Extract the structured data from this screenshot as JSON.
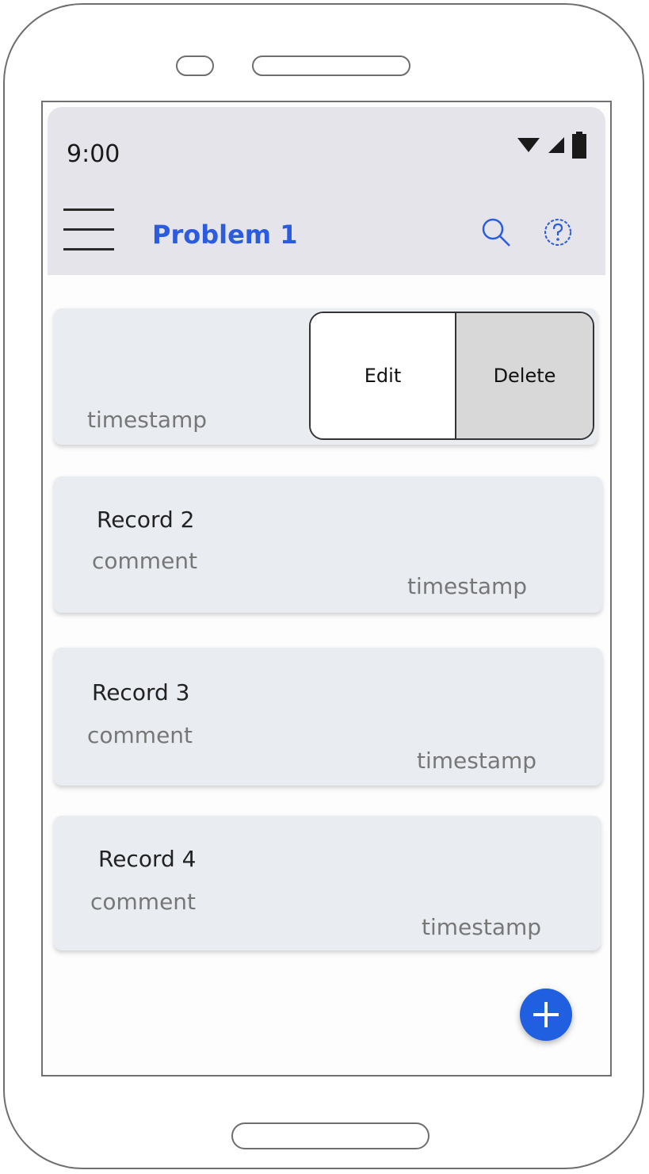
{
  "status_bar": {
    "time": "9:00"
  },
  "app_bar": {
    "title": "Problem 1"
  },
  "records": [
    {
      "title": "",
      "comment": "",
      "timestamp": "timestamp",
      "swiped": true
    },
    {
      "title": "Record 2",
      "comment": "comment",
      "timestamp": "timestamp"
    },
    {
      "title": "Record 3",
      "comment": "comment",
      "timestamp": "timestamp"
    },
    {
      "title": "Record 4",
      "comment": "comment",
      "timestamp": "timestamp"
    }
  ],
  "swipe_actions": {
    "edit_label": "Edit",
    "delete_label": "Delete"
  },
  "colors": {
    "accent": "#2b5ce0",
    "fab": "#1f5fe0",
    "topbar": "#e5e4ea",
    "card": "#e9ecf1",
    "delete_bg": "#d8d8d8"
  },
  "icons": [
    "menu-icon",
    "search-icon",
    "help-icon",
    "wifi-icon",
    "signal-icon",
    "battery-icon",
    "add-icon"
  ]
}
